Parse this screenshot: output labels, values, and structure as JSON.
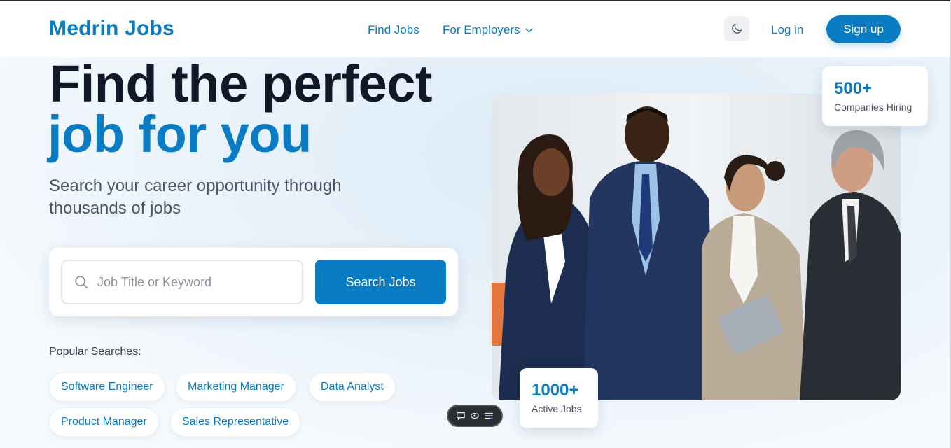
{
  "brand": {
    "name": "Medrin Jobs",
    "accent": "#0a7cc4"
  },
  "nav": {
    "find_jobs": "Find Jobs",
    "for_employers": "For Employers",
    "theme_toggle_icon": "moon-icon",
    "login": "Log in",
    "signup": "Sign up"
  },
  "hero": {
    "title_line1": "Find the perfect",
    "title_line2": "job for you",
    "subtitle": "Search your career opportunity through thousands of jobs"
  },
  "search": {
    "placeholder": "Job Title or Keyword",
    "value": "",
    "button": "Search Jobs"
  },
  "popular": {
    "label": "Popular Searches:",
    "items": [
      "Software Engineer",
      "Marketing Manager",
      "Data Analyst",
      "Product Manager",
      "Sales Representative"
    ]
  },
  "stats": {
    "companies": {
      "value": "500+",
      "label": "Companies Hiring"
    },
    "jobs": {
      "value": "1000+",
      "label": "Active Jobs"
    }
  },
  "toolbar": {
    "icons": [
      "comment-icon",
      "eye-icon",
      "list-icon"
    ]
  }
}
